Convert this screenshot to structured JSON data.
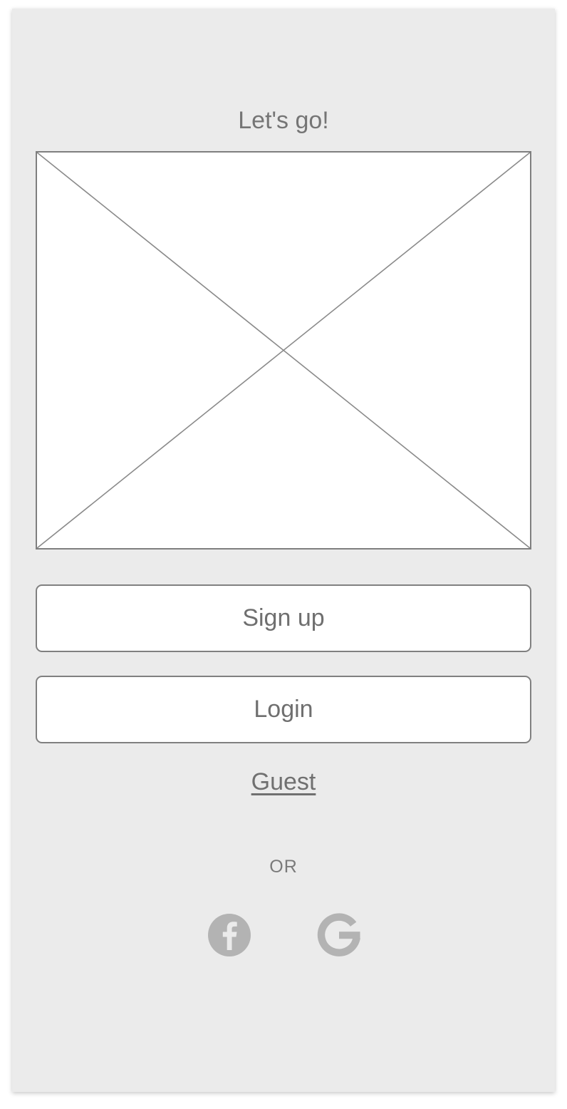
{
  "screen": {
    "title": "Let's go!",
    "hero_image": {
      "icon": "image-placeholder-icon"
    },
    "buttons": {
      "signup_label": "Sign up",
      "login_label": "Login"
    },
    "guest_link": "Guest",
    "divider_text": "OR",
    "social": [
      {
        "name": "facebook",
        "icon": "facebook-icon"
      },
      {
        "name": "google",
        "icon": "google-icon"
      }
    ]
  },
  "colors": {
    "background": "#ebebeb",
    "text": "#757575",
    "border": "#808080",
    "social_icon": "#b3b3b3"
  }
}
